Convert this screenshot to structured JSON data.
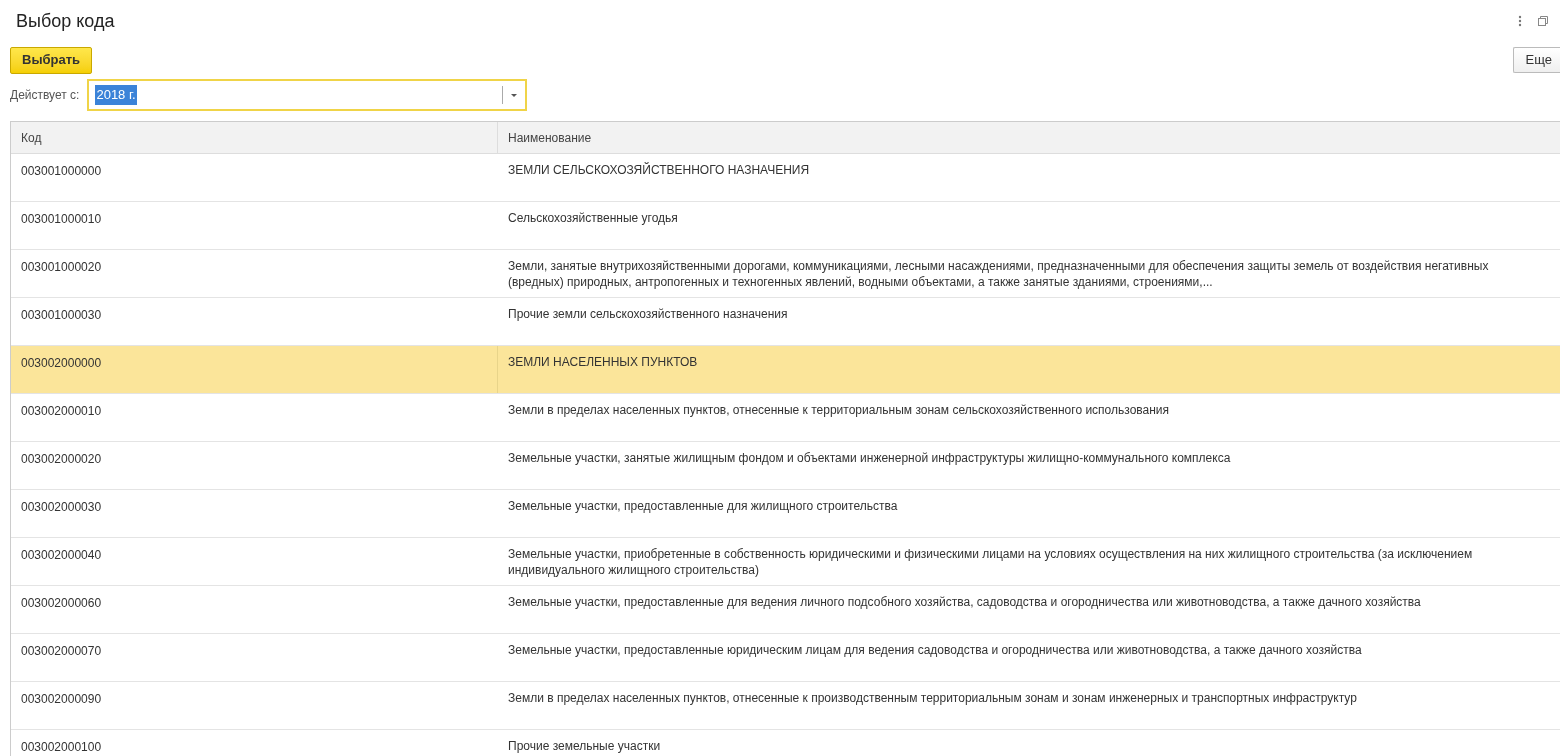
{
  "window": {
    "title": "Выбор кода"
  },
  "toolbar": {
    "select_button": "Выбрать",
    "more_button": "Еще"
  },
  "filter": {
    "label": "Действует с:",
    "value": "2018 г."
  },
  "table": {
    "columns": [
      "Код",
      "Наименование"
    ],
    "rows": [
      {
        "code": "003001000000",
        "name": "ЗЕМЛИ СЕЛЬСКОХОЗЯЙСТВЕННОГО НАЗНАЧЕНИЯ",
        "selected": false
      },
      {
        "code": "003001000010",
        "name": "Сельскохозяйственные угодья",
        "selected": false
      },
      {
        "code": "003001000020",
        "name": "Земли, занятые внутрихозяйственными дорогами, коммуникациями, лесными насаждениями, предназначенными для обеспечения защиты земель от воздействия негативных (вредных) природных, антропогенных и техногенных явлений, водными объектами, а также занятые зданиями, строениями,...",
        "selected": false
      },
      {
        "code": "003001000030",
        "name": "Прочие земли сельскохозяйственного назначения",
        "selected": false
      },
      {
        "code": "003002000000",
        "name": "ЗЕМЛИ НАСЕЛЕННЫХ ПУНКТОВ",
        "selected": true
      },
      {
        "code": "003002000010",
        "name": "Земли в пределах населенных пунктов, отнесенные к территориальным зонам сельскохозяйственного использования",
        "selected": false
      },
      {
        "code": "003002000020",
        "name": "Земельные участки, занятые жилищным фондом и объектами инженерной инфраструктуры жилищно-коммунального комплекса",
        "selected": false
      },
      {
        "code": "003002000030",
        "name": "Земельные участки, предоставленные для жилищного строительства",
        "selected": false
      },
      {
        "code": "003002000040",
        "name": "Земельные участки, приобретенные в собственность юридическими и физическими лицами на условиях осуществления на них жилищного строительства (за исключением индивидуального жилищного строительства)",
        "selected": false
      },
      {
        "code": "003002000060",
        "name": "Земельные участки, предоставленные для ведения личного подсобного хозяйства, садоводства и огородничества или животноводства, а также дачного хозяйства",
        "selected": false
      },
      {
        "code": "003002000070",
        "name": "Земельные участки, предоставленные юридическим лицам для ведения садоводства и огородничества или животноводства, а также дачного хозяйства",
        "selected": false
      },
      {
        "code": "003002000090",
        "name": "Земли в пределах населенных пунктов, отнесенные к производственным территориальным зонам и зонам инженерных и транспортных инфраструктур",
        "selected": false
      },
      {
        "code": "003002000100",
        "name": "Прочие земельные участки",
        "selected": false
      }
    ]
  }
}
